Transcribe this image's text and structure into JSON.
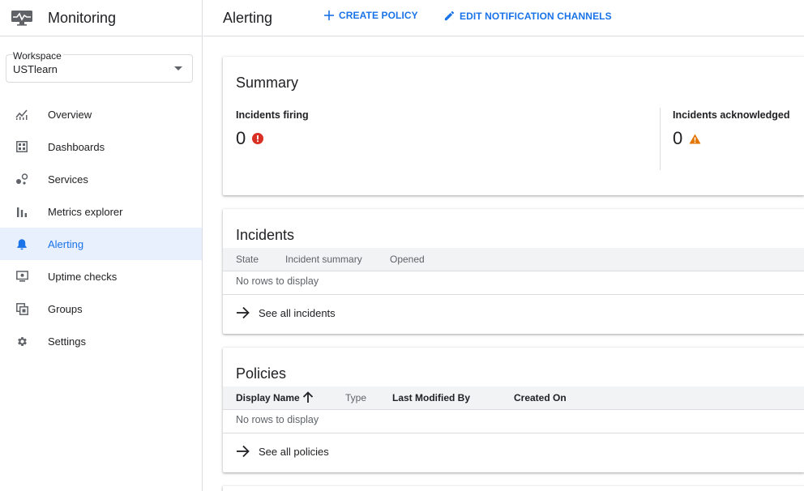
{
  "app": {
    "title": "Monitoring"
  },
  "workspace": {
    "label": "Workspace",
    "value": "USTlearn"
  },
  "sidebar": {
    "items": [
      {
        "label": "Overview",
        "icon": "chart-line-icon"
      },
      {
        "label": "Dashboards",
        "icon": "dashboard-icon"
      },
      {
        "label": "Services",
        "icon": "services-icon"
      },
      {
        "label": "Metrics explorer",
        "icon": "bar-chart-icon"
      },
      {
        "label": "Alerting",
        "icon": "bell-icon",
        "active": true
      },
      {
        "label": "Uptime checks",
        "icon": "monitor-icon"
      },
      {
        "label": "Groups",
        "icon": "groups-icon"
      },
      {
        "label": "Settings",
        "icon": "gear-icon"
      }
    ]
  },
  "header": {
    "title": "Alerting",
    "create_policy": "CREATE POLICY",
    "edit_channels": "EDIT NOTIFICATION CHANNELS"
  },
  "summary": {
    "title": "Summary",
    "firing_label": "Incidents firing",
    "firing_value": "0",
    "ack_label": "Incidents acknowledged",
    "ack_value": "0"
  },
  "incidents": {
    "title": "Incidents",
    "columns": [
      "State",
      "Incident summary",
      "Opened"
    ],
    "empty": "No rows to display",
    "see_all": "See all incidents"
  },
  "policies": {
    "title": "Policies",
    "columns": [
      "Display Name",
      "Type",
      "Last Modified By",
      "Created On"
    ],
    "empty": "No rows to display",
    "see_all": "See all policies"
  },
  "colors": {
    "accent": "#1a73e8",
    "error": "#d93025",
    "warning": "#e37400",
    "active_bg": "#e8f0fe"
  }
}
